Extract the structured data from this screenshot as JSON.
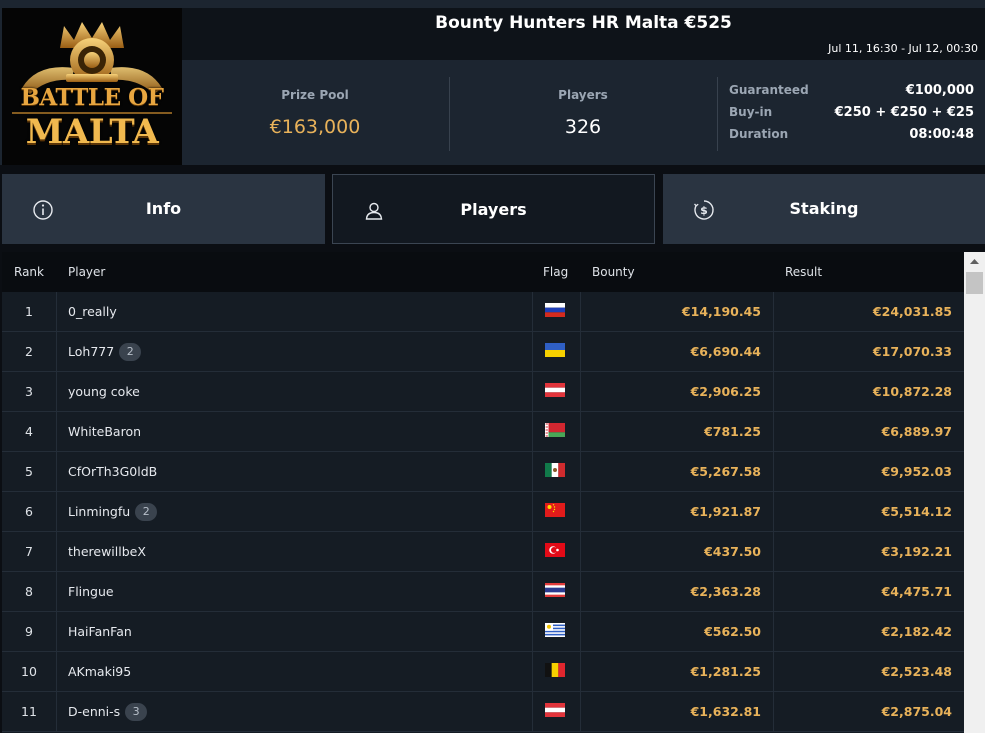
{
  "header": {
    "logo_line1": "BATTLE OF",
    "logo_line2": "MALTA",
    "title": "Bounty Hunters HR Malta €525",
    "date_range": "Jul 11, 16:30 - Jul 12, 00:30"
  },
  "stats": {
    "prize_pool_label": "Prize Pool",
    "prize_pool_value": "€163,000",
    "players_label": "Players",
    "players_value": "326",
    "details": [
      {
        "label": "Guaranteed",
        "value": "€100,000"
      },
      {
        "label": "Buy-in",
        "value": "€250 + €250 + €25"
      },
      {
        "label": "Duration",
        "value": "08:00:48"
      }
    ]
  },
  "tabs": [
    {
      "label": "Info",
      "icon": "info-icon",
      "active": false
    },
    {
      "label": "Players",
      "icon": "user-icon",
      "active": true
    },
    {
      "label": "Staking",
      "icon": "staking-coin-icon",
      "active": false
    }
  ],
  "table": {
    "columns": {
      "rank": "Rank",
      "player": "Player",
      "flag": "Flag",
      "bounty": "Bounty",
      "result": "Result"
    },
    "rows": [
      {
        "rank": "1",
        "player": "0_really",
        "badge": "",
        "flag": "russia-flag-icon",
        "bounty": "€14,190.45",
        "result": "€24,031.85"
      },
      {
        "rank": "2",
        "player": "Loh777",
        "badge": "2",
        "flag": "ukraine-flag-icon",
        "bounty": "€6,690.44",
        "result": "€17,070.33"
      },
      {
        "rank": "3",
        "player": "young coke",
        "badge": "",
        "flag": "austria-flag-icon",
        "bounty": "€2,906.25",
        "result": "€10,872.28"
      },
      {
        "rank": "4",
        "player": "WhiteBaron",
        "badge": "",
        "flag": "belarus-flag-icon",
        "bounty": "€781.25",
        "result": "€6,889.97"
      },
      {
        "rank": "5",
        "player": "CfOrTh3G0ldB",
        "badge": "",
        "flag": "mexico-flag-icon",
        "bounty": "€5,267.58",
        "result": "€9,952.03"
      },
      {
        "rank": "6",
        "player": "Linmingfu",
        "badge": "2",
        "flag": "china-flag-icon",
        "bounty": "€1,921.87",
        "result": "€5,514.12"
      },
      {
        "rank": "7",
        "player": "therewillbeX",
        "badge": "",
        "flag": "turkey-flag-icon",
        "bounty": "€437.50",
        "result": "€3,192.21"
      },
      {
        "rank": "8",
        "player": "Flingue",
        "badge": "",
        "flag": "thailand-flag-icon",
        "bounty": "€2,363.28",
        "result": "€4,475.71"
      },
      {
        "rank": "9",
        "player": "HaiFanFan",
        "badge": "",
        "flag": "uruguay-flag-icon",
        "bounty": "€562.50",
        "result": "€2,182.42"
      },
      {
        "rank": "10",
        "player": "AKmaki95",
        "badge": "",
        "flag": "belgium-flag-icon",
        "bounty": "€1,281.25",
        "result": "€2,523.48"
      },
      {
        "rank": "11",
        "player": "D-enni-s",
        "badge": "3",
        "flag": "austria-flag-icon",
        "bounty": "€1,632.81",
        "result": "€2,875.04"
      }
    ]
  }
}
